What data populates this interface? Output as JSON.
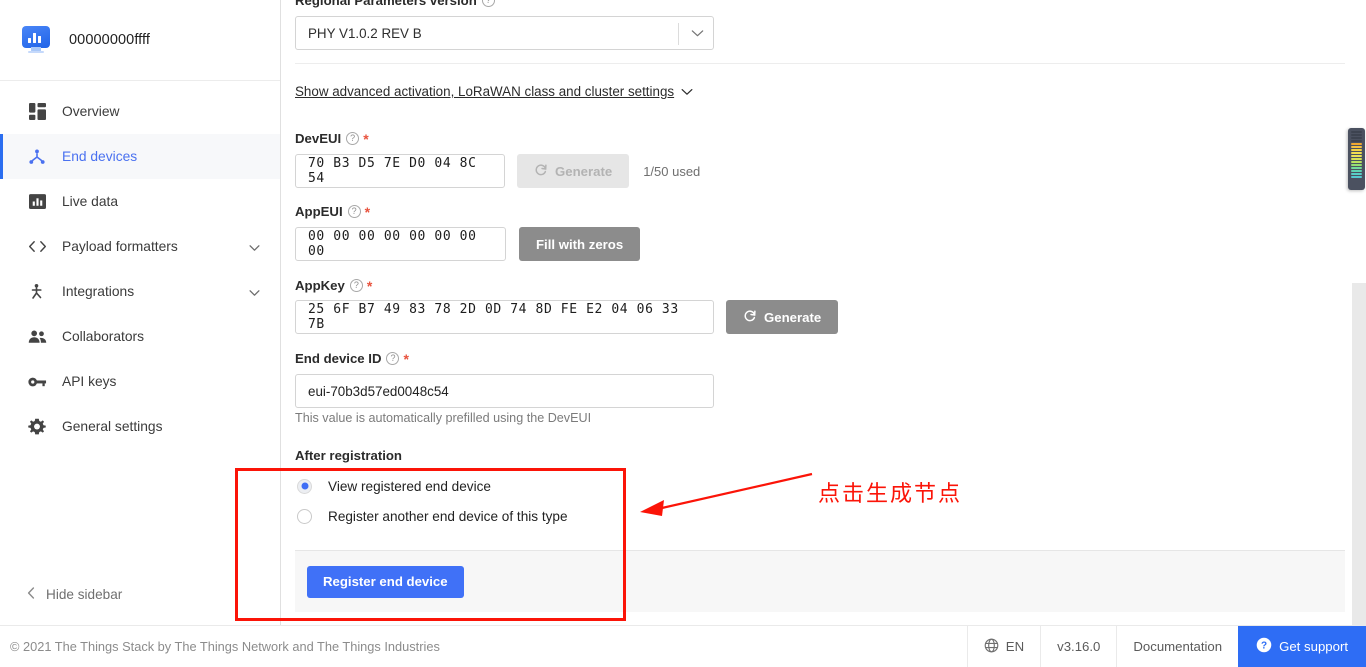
{
  "app": {
    "name": "00000000ffff",
    "logo_icon": "bar-chart-monitor-icon"
  },
  "sidebar": {
    "items": [
      {
        "label": "Overview",
        "icon": "grid-icon",
        "active": false,
        "expandable": false
      },
      {
        "label": "End devices",
        "icon": "devices-node-icon",
        "active": true,
        "expandable": false
      },
      {
        "label": "Live data",
        "icon": "bar-chart-icon",
        "active": false,
        "expandable": false
      },
      {
        "label": "Payload formatters",
        "icon": "code-brackets-icon",
        "active": false,
        "expandable": true
      },
      {
        "label": "Integrations",
        "icon": "integrations-icon",
        "active": false,
        "expandable": true
      },
      {
        "label": "Collaborators",
        "icon": "people-icon",
        "active": false,
        "expandable": false
      },
      {
        "label": "API keys",
        "icon": "key-icon",
        "active": false,
        "expandable": false
      },
      {
        "label": "General settings",
        "icon": "gear-icon",
        "active": false,
        "expandable": false
      }
    ],
    "hide_sidebar_label": "Hide sidebar",
    "hide_sidebar_icon": "chevron-left-icon"
  },
  "form": {
    "regional_parameters": {
      "label": "Regional Parameters version",
      "help_icon": "question-circle-icon",
      "value": "PHY V1.0.2 REV B",
      "caret_icon": "chevron-down-icon"
    },
    "advanced_link": {
      "label": "Show advanced activation, LoRaWAN class and cluster settings",
      "caret_icon": "chevron-down-icon"
    },
    "dev_eui": {
      "label": "DevEUI",
      "required_mark": "*",
      "help_icon": "question-circle-icon",
      "value": "70 B3 D5 7E D0 04 8C 54",
      "generate_label": "Generate",
      "generate_icon": "refresh-icon",
      "generate_disabled": true,
      "used_text": "1/50 used"
    },
    "app_eui": {
      "label": "AppEUI",
      "required_mark": "*",
      "help_icon": "question-circle-icon",
      "value": "00 00 00 00 00 00 00 00",
      "fill_label": "Fill with zeros"
    },
    "app_key": {
      "label": "AppKey",
      "required_mark": "*",
      "help_icon": "question-circle-icon",
      "value": "25 6F B7 49 83 78 2D 0D 74 8D FE E2 04 06 33 7B",
      "generate_label": "Generate",
      "generate_icon": "refresh-icon"
    },
    "end_device_id": {
      "label": "End device ID",
      "required_mark": "*",
      "help_icon": "question-circle-icon",
      "value": "eui-70b3d57ed0048c54",
      "hint": "This value is automatically prefilled using the DevEUI"
    },
    "after_registration": {
      "label": "After registration",
      "options": [
        {
          "label": "View registered end device",
          "selected": true
        },
        {
          "label": "Register another end device of this type",
          "selected": false
        }
      ]
    },
    "submit": {
      "label": "Register end device"
    }
  },
  "footer": {
    "copyright": "© 2021 The Things Stack by The Things Network and The Things Industries",
    "language": "EN",
    "language_icon": "globe-icon",
    "version": "v3.16.0",
    "documentation": "Documentation",
    "support": "Get support",
    "support_icon": "question-circle-filled-icon"
  },
  "annotation": {
    "text": "点击生成节点",
    "color": "#fb1408",
    "arrow_icon": "arrow-left-icon",
    "box_icon": "highlight-rectangle"
  },
  "edge_widget": {
    "colors": [
      "#3d4350",
      "#3d4350",
      "#3d4350",
      "#3d4350",
      "#f0a830",
      "#f5c242",
      "#f3d244",
      "#f0de52",
      "#e8e157",
      "#d6e257",
      "#b9e05f",
      "#96dd72",
      "#72d99a",
      "#5fd4b4",
      "#59cfc6",
      "#55c9cf"
    ]
  }
}
